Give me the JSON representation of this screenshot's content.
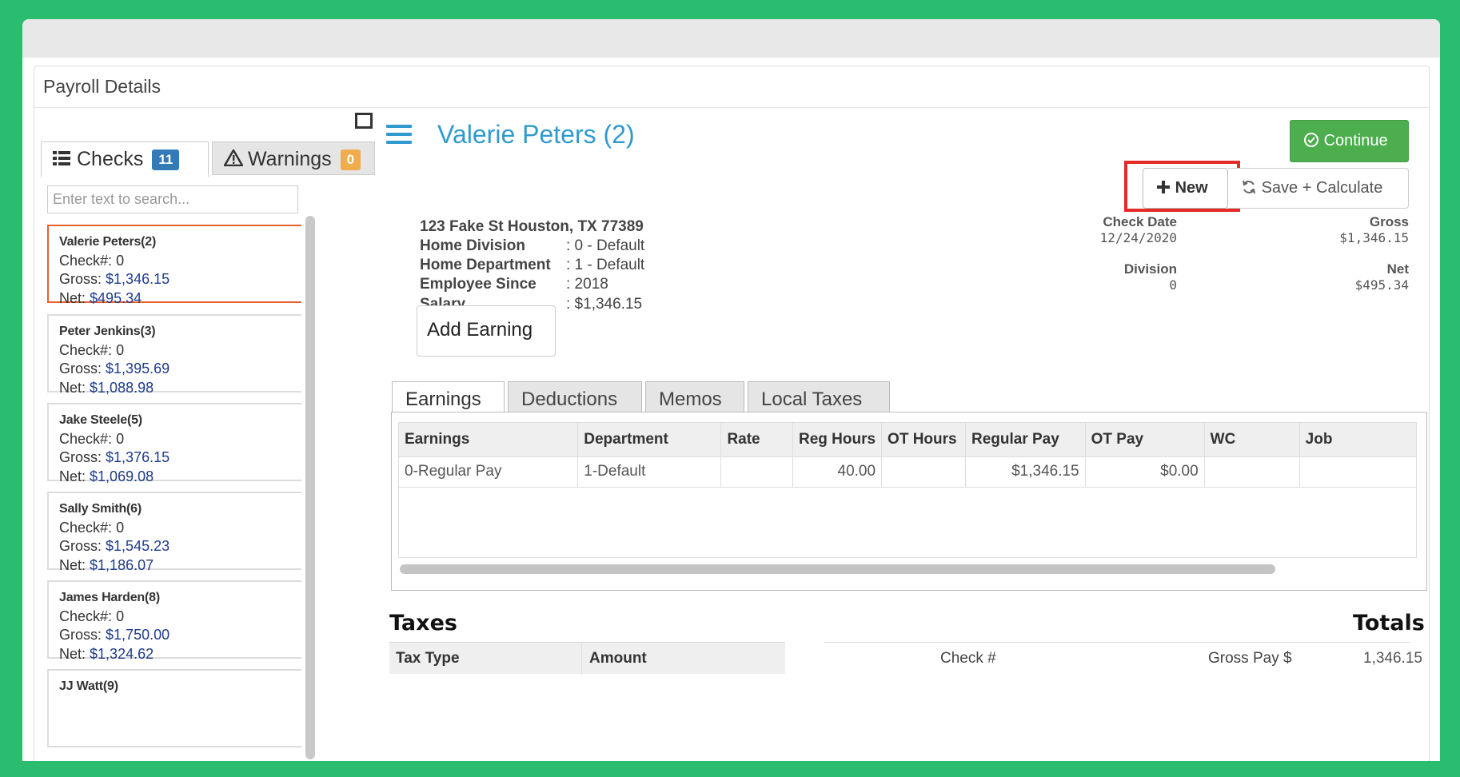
{
  "panel": {
    "title": "Payroll Details"
  },
  "tabs": {
    "checks": {
      "label": "Checks",
      "count": "11"
    },
    "warnings": {
      "label": "Warnings",
      "count": "0"
    }
  },
  "search": {
    "placeholder": "Enter text to search..."
  },
  "checks": [
    {
      "name": "Valerie Peters(2)",
      "check_label": "Check#:",
      "check_no": "0",
      "gross_label": "Gross:",
      "gross": "$1,346.15",
      "net_label": "Net:",
      "net": "$495.34"
    },
    {
      "name": "Peter Jenkins(3)",
      "check_label": "Check#:",
      "check_no": "0",
      "gross_label": "Gross:",
      "gross": "$1,395.69",
      "net_label": "Net:",
      "net": "$1,088.98"
    },
    {
      "name": "Jake Steele(5)",
      "check_label": "Check#:",
      "check_no": "0",
      "gross_label": "Gross:",
      "gross": "$1,376.15",
      "net_label": "Net:",
      "net": "$1,069.08"
    },
    {
      "name": "Sally Smith(6)",
      "check_label": "Check#:",
      "check_no": "0",
      "gross_label": "Gross:",
      "gross": "$1,545.23",
      "net_label": "Net:",
      "net": "$1,186.07"
    },
    {
      "name": "James Harden(8)",
      "check_label": "Check#:",
      "check_no": "0",
      "gross_label": "Gross:",
      "gross": "$1,750.00",
      "net_label": "Net:",
      "net": "$1,324.62"
    },
    {
      "name": "JJ Watt(9)"
    }
  ],
  "employee": {
    "title": "Valerie Peters (2)",
    "address": "123 Fake St Houston, TX 77389",
    "info": [
      {
        "label": "Home Division",
        "value": ": 0 - Default"
      },
      {
        "label": "Home Department",
        "value": ": 1 - Default"
      },
      {
        "label": "Employee Since",
        "value": ": 2018"
      },
      {
        "label": "Salary",
        "value": ": $1,346.15"
      }
    ]
  },
  "meta": {
    "check_date_label": "Check Date",
    "check_date": "12/24/2020",
    "gross_label": "Gross",
    "gross": "$1,346.15",
    "division_label": "Division",
    "division": "0",
    "net_label": "Net",
    "net": "$495.34"
  },
  "buttons": {
    "continue": "Continue",
    "new": "New",
    "save_calculate": "Save + Calculate",
    "add_earning": "Add Earning"
  },
  "earnings_tabs": [
    "Earnings",
    "Deductions",
    "Memos",
    "Local Taxes"
  ],
  "earnings_table": {
    "columns": [
      "Earnings",
      "Department",
      "Rate",
      "Reg Hours",
      "OT Hours",
      "Regular Pay",
      "OT Pay",
      "WC",
      "Job"
    ],
    "rows": [
      [
        "0-Regular Pay",
        "1-Default",
        "",
        "40.00",
        "",
        "$1,346.15",
        "$0.00",
        "",
        ""
      ]
    ]
  },
  "taxes": {
    "heading": "Taxes",
    "columns": [
      "Tax Type",
      "Amount"
    ]
  },
  "totals": {
    "heading": "Totals",
    "check_label": "Check #",
    "gross_pay_label": "Gross Pay $",
    "gross_pay": "1,346.15"
  },
  "colors": {
    "accent": "#2e9ad0",
    "continue_green": "#4cae4c",
    "active_card_border": "#e8602c",
    "highlight_red": "#e52a2a",
    "badge_blue": "#337ab7",
    "badge_orange": "#f0ad4e",
    "money_blue": "#1e3c8c"
  }
}
